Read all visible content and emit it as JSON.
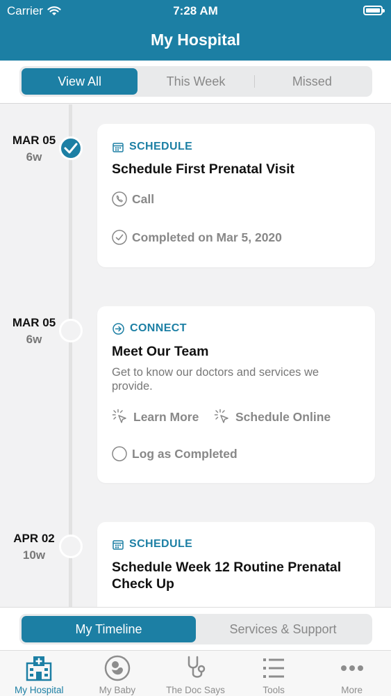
{
  "status_bar": {
    "carrier": "Carrier",
    "time": "7:28 AM"
  },
  "header": {
    "title": "My Hospital"
  },
  "filter_tabs": [
    {
      "label": "View All",
      "active": true
    },
    {
      "label": "This Week",
      "active": false
    },
    {
      "label": "Missed",
      "active": false
    }
  ],
  "timeline": [
    {
      "date": "MAR 05",
      "week": "6w",
      "completed": true,
      "category": "SCHEDULE",
      "category_icon": "calendar-icon",
      "title": "Schedule First Prenatal Visit",
      "actions": [
        {
          "label": "Call",
          "icon": "phone-icon"
        },
        {
          "label": "Completed on Mar 5, 2020",
          "icon": "check-circle-icon"
        }
      ]
    },
    {
      "date": "MAR 05",
      "week": "6w",
      "completed": false,
      "category": "CONNECT",
      "category_icon": "arrow-circle-icon",
      "title": "Meet Our Team",
      "description": "Get to know our doctors and services we provide.",
      "actions": [
        {
          "label": "Learn More",
          "icon": "cursor-click-icon"
        },
        {
          "label": "Schedule Online",
          "icon": "cursor-click-icon"
        },
        {
          "label": "Log as Completed",
          "icon": "empty-circle-icon"
        }
      ]
    },
    {
      "date": "APR 02",
      "week": "10w",
      "completed": false,
      "category": "SCHEDULE",
      "category_icon": "calendar-icon",
      "title": "Schedule Week 12 Routine Prenatal Check Up"
    }
  ],
  "bottom_segment": [
    {
      "label": "My Timeline",
      "active": true
    },
    {
      "label": "Services & Support",
      "active": false
    }
  ],
  "tab_bar": [
    {
      "label": "My Hospital",
      "icon": "hospital-icon",
      "active": true
    },
    {
      "label": "My Baby",
      "icon": "baby-icon",
      "active": false
    },
    {
      "label": "The Doc Says",
      "icon": "stethoscope-icon",
      "active": false
    },
    {
      "label": "Tools",
      "icon": "list-icon",
      "active": false
    },
    {
      "label": "More",
      "icon": "more-icon",
      "active": false
    }
  ],
  "colors": {
    "brand": "#1c7fa4",
    "background": "#f2f2f3",
    "muted": "#888888"
  }
}
